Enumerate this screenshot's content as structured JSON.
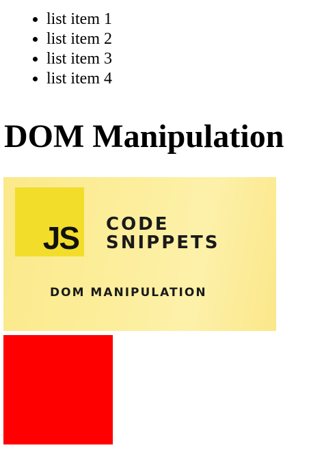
{
  "list": {
    "items": [
      {
        "label": "list item 1"
      },
      {
        "label": "list item 2"
      },
      {
        "label": "list item 3"
      },
      {
        "label": "list item 4"
      }
    ]
  },
  "heading": "DOM Manipulation",
  "banner": {
    "badge": "JS",
    "line1": "CODE",
    "line2": "SNIPPETS",
    "subtitle": "DOM MANIPULATION"
  },
  "colors": {
    "banner_yellow": "#fcee9c",
    "badge_yellow": "#f2dd2a",
    "box_red": "#ff0000"
  }
}
